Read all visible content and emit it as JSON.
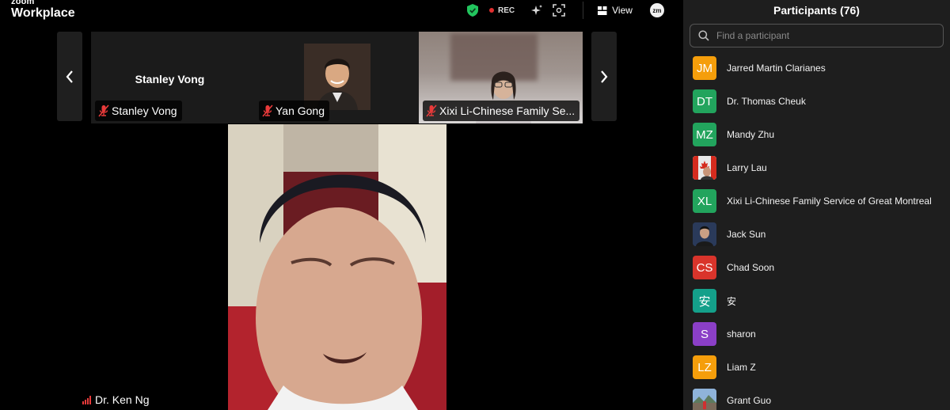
{
  "app": {
    "brand_small": "zoom",
    "brand_big": "Workplace"
  },
  "topbar": {
    "rec_label": "REC",
    "view_label": "View",
    "avatar_initials": "zm",
    "colors": {
      "shield": "#22c55e",
      "rec_dot": "#e02f2f"
    }
  },
  "gallery": {
    "tiles": [
      {
        "center_name": "Stanley Vong",
        "label": "Stanley Vong",
        "muted": true
      },
      {
        "label": "Yan Gong",
        "muted": true
      },
      {
        "label": "Xixi Li-Chinese Family Se...",
        "muted": true
      }
    ]
  },
  "speaker": {
    "name": "Dr. Ken Ng",
    "signal_color": "#e83a3a"
  },
  "participants": {
    "title": "Participants (76)",
    "search_placeholder": "Find a participant",
    "items": [
      {
        "initials": "JM",
        "color": "#f59e0b",
        "name": "Jarred Martin Clarianes"
      },
      {
        "initials": "DT",
        "color": "#22a45d",
        "name": "Dr. Thomas Cheuk"
      },
      {
        "initials": "MZ",
        "color": "#22a45d",
        "name": "Mandy Zhu"
      },
      {
        "initials": "",
        "color": "#d9d9d9",
        "name": "Larry Lau",
        "photo": "canada-flag-photo"
      },
      {
        "initials": "XL",
        "color": "#22a45d",
        "name": "Xixi Li-Chinese Family Service of Great Montreal"
      },
      {
        "initials": "",
        "color": "#2a3a5a",
        "name": "Jack Sun",
        "photo": "person-photo"
      },
      {
        "initials": "CS",
        "color": "#d9342b",
        "name": "Chad Soon"
      },
      {
        "initials": "安",
        "color": "#14a08a",
        "name": "安"
      },
      {
        "initials": "S",
        "color": "#8b3fc7",
        "name": "sharon"
      },
      {
        "initials": "LZ",
        "color": "#f59e0b",
        "name": "Liam Z"
      },
      {
        "initials": "",
        "color": "#8fb3d9",
        "name": "Grant Guo",
        "photo": "outdoor-photo"
      }
    ]
  }
}
